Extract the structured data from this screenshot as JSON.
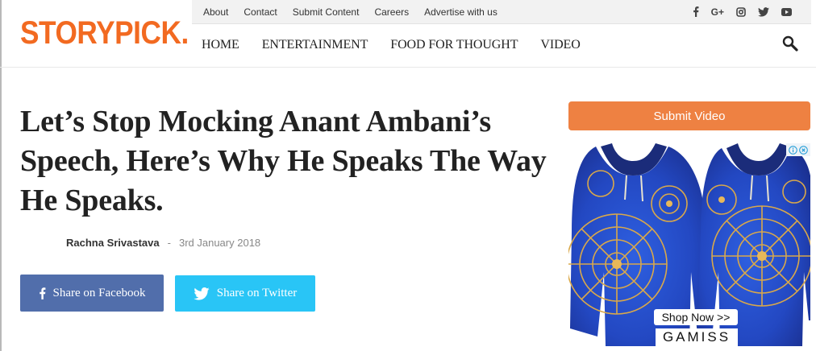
{
  "header": {
    "logo_text": "STORYPICK.",
    "top_links": [
      "About",
      "Contact",
      "Submit Content",
      "Careers",
      "Advertise with us"
    ],
    "social_icons": [
      "facebook-icon",
      "google-plus-icon",
      "instagram-icon",
      "twitter-icon",
      "youtube-icon"
    ],
    "google_plus_label": "G+",
    "nav": [
      "HOME",
      "ENTERTAINMENT",
      "FOOD FOR THOUGHT",
      "VIDEO"
    ]
  },
  "article": {
    "title": "Let’s Stop Mocking Anant Ambani’s Speech, Here’s Why He Speaks The Way He Speaks.",
    "author": "Rachna Srivastava",
    "separator": "-",
    "date": "3rd January 2018",
    "share_facebook": "Share on Facebook",
    "share_twitter": "Share on Twitter"
  },
  "sidebar": {
    "submit_video": "Submit Video",
    "ad": {
      "cta": "Shop Now >>",
      "brand": "GAMISS"
    }
  },
  "colors": {
    "logo": "#f26a21",
    "facebook": "#516eab",
    "twitter": "#29c5f6",
    "submit": "#ee8142"
  }
}
